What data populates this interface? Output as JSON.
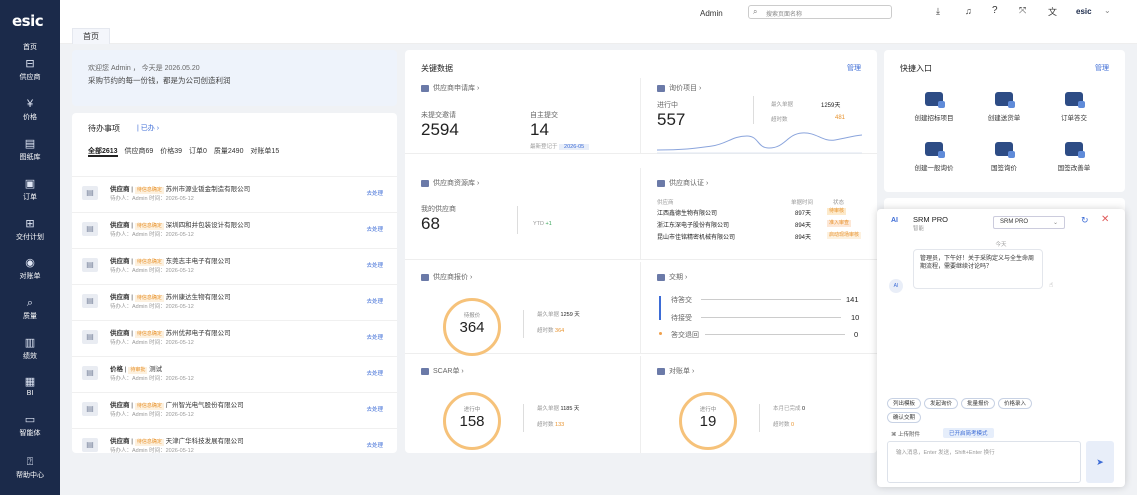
{
  "sidebar": {
    "logo": "esic",
    "items": [
      {
        "label": "首页",
        "icon": "home-icon"
      },
      {
        "label": "供应商",
        "icon": "supplier-icon"
      },
      {
        "label": "价格",
        "icon": "yen-icon"
      },
      {
        "label": "图纸库",
        "icon": "drawing-icon"
      },
      {
        "label": "订单",
        "icon": "order-icon"
      },
      {
        "label": "交付计划",
        "icon": "delivery-icon"
      },
      {
        "label": "对账单",
        "icon": "reconcile-icon"
      },
      {
        "label": "质量",
        "icon": "quality-icon"
      },
      {
        "label": "绩效",
        "icon": "performance-icon"
      },
      {
        "label": "BI",
        "icon": "bi-icon"
      },
      {
        "label": "智能体",
        "icon": "agent-icon"
      },
      {
        "label": "帮助中心",
        "icon": "help-icon"
      }
    ]
  },
  "topbar": {
    "user": "Admin",
    "search_placeholder": "搜索页面名称",
    "brand": "esic"
  },
  "tabs": [
    {
      "label": "首页"
    }
  ],
  "welcome": {
    "line1": "欢迎您 Admin ， 今天是 2026.05.20",
    "line2": "采购节约的每一份钱，都是为公司创造利润"
  },
  "todo": {
    "title": "待办事项",
    "filter": "已办",
    "counts": [
      {
        "label": "全部",
        "value": "2613"
      },
      {
        "label": "供应商",
        "value": "69"
      },
      {
        "label": "价格",
        "value": "39"
      },
      {
        "label": "订单",
        "value": "0"
      },
      {
        "label": "质量",
        "value": "2490"
      },
      {
        "label": "对账单",
        "value": "15"
      }
    ],
    "items": [
      {
        "type": "供应商",
        "status": "待信息确定",
        "name": "苏州市源业钣金制造有限公司",
        "meta": "待办人：Admin    时间：2026-05-12",
        "action": "去处理"
      },
      {
        "type": "供应商",
        "status": "待信息确定",
        "name": "深圳四和并包装设计有限公司",
        "meta": "待办人：Admin    时间：2026-05-12",
        "action": "去处理"
      },
      {
        "type": "供应商",
        "status": "待信息确定",
        "name": "东莞志丰电子有限公司",
        "meta": "待办人：Admin    时间：2026-05-12",
        "action": "去处理"
      },
      {
        "type": "供应商",
        "status": "待信息确定",
        "name": "苏州康达生物有限公司",
        "meta": "待办人：Admin    时间：2026-05-12",
        "action": "去处理"
      },
      {
        "type": "供应商",
        "status": "待信息确定",
        "name": "苏州优邦电子有限公司",
        "meta": "待办人：Admin    时间：2026-05-12",
        "action": "去处理"
      },
      {
        "type": "价格",
        "status": "待审批",
        "name": "测试",
        "meta": "待办人：Admin    时间：2026-05-12",
        "action": "去处理"
      },
      {
        "type": "供应商",
        "status": "待信息确定",
        "name": "广州智光电气股份有限公司",
        "meta": "待办人：Admin    时间：2026-05-12",
        "action": "去处理"
      },
      {
        "type": "供应商",
        "status": "待信息确定",
        "name": "天津广华科技发展有限公司",
        "meta": "待办人：Admin    时间：2026-05-12",
        "action": "去处理"
      }
    ]
  },
  "key": {
    "title": "关键数据",
    "manage": "管理",
    "supplier_apply": {
      "title": "供应商申请库",
      "a_label": "未提交邀请",
      "a_value": "2594",
      "b_label": "自主提交",
      "b_value": "14",
      "latest_label": "最新登记于",
      "latest_date": "2026-05"
    },
    "inquiry": {
      "title": "询价项目",
      "l1": "进行中",
      "v1": "557",
      "k1": "最久单据",
      "k1v": "1259天",
      "k2": "超时数",
      "k2v": "481"
    },
    "pool": {
      "title": "供应商资源库",
      "label": "我的供应商",
      "value": "68",
      "ytd": "YTD",
      "ytd_v": "+1"
    },
    "cert": {
      "title": "供应商认证",
      "h1": "供应商",
      "h2": "单据时间",
      "h3": "状态",
      "rows": [
        {
          "n": "江西鑫德生物有限公司",
          "d": "897天",
          "s": "待审核"
        },
        {
          "n": "浙江东深电子股份有限公司",
          "d": "894天",
          "s": "准入审查"
        },
        {
          "n": "昆山市佳铭精密机械有限公司",
          "d": "894天",
          "s": "启动现场审核"
        }
      ]
    },
    "quote": {
      "title": "供应商报价",
      "ring_l": "待报价",
      "ring_v": "364",
      "k1": "最久单据",
      "k1v": "1259 天",
      "k2": "超时数",
      "k2v": "364"
    },
    "deliver": {
      "title": "交期",
      "r1": "待答交",
      "r1v": "141",
      "r2": "待接受",
      "r2v": "10",
      "r3": "答交退回",
      "r3v": "0"
    },
    "scar": {
      "title": "SCAR单",
      "ring_l": "进行中",
      "ring_v": "158",
      "k1": "最久单据",
      "k1v": "1185 天",
      "k2": "超时数",
      "k2v": "133"
    },
    "statement": {
      "title": "对账单",
      "ring_l": "进行中",
      "ring_v": "19",
      "k1": "本月已完成",
      "k1v": "0",
      "k2": "超时数",
      "k2v": "0"
    }
  },
  "quick": {
    "title": "快捷入口",
    "manage": "管理",
    "items": [
      "创建招标项目",
      "创建送货单",
      "订单答交",
      "创建一般询价",
      "国签询价",
      "国签改善单"
    ]
  },
  "chat": {
    "title": "SRM PRO",
    "subtitle": "智能",
    "select": "SRM PRO",
    "day": "今天",
    "avatar": "AI",
    "message": "管理员，下午好！关于采购定义与全生命周期流程，需要继续讨论吗？",
    "chips": [
      "列出模板",
      "发起询价",
      "批量报价",
      "价格录入",
      "确认交期"
    ],
    "attach": "上传附件",
    "mode": "已开启简考模式",
    "input_placeholder": "输入消息，Enter 发送，Shift+Enter 换行"
  },
  "colors": {
    "sidebar": "#1b2a4a",
    "accent": "#3d6cd6",
    "ring": "#f6c27a",
    "tag": "#e8932e"
  }
}
